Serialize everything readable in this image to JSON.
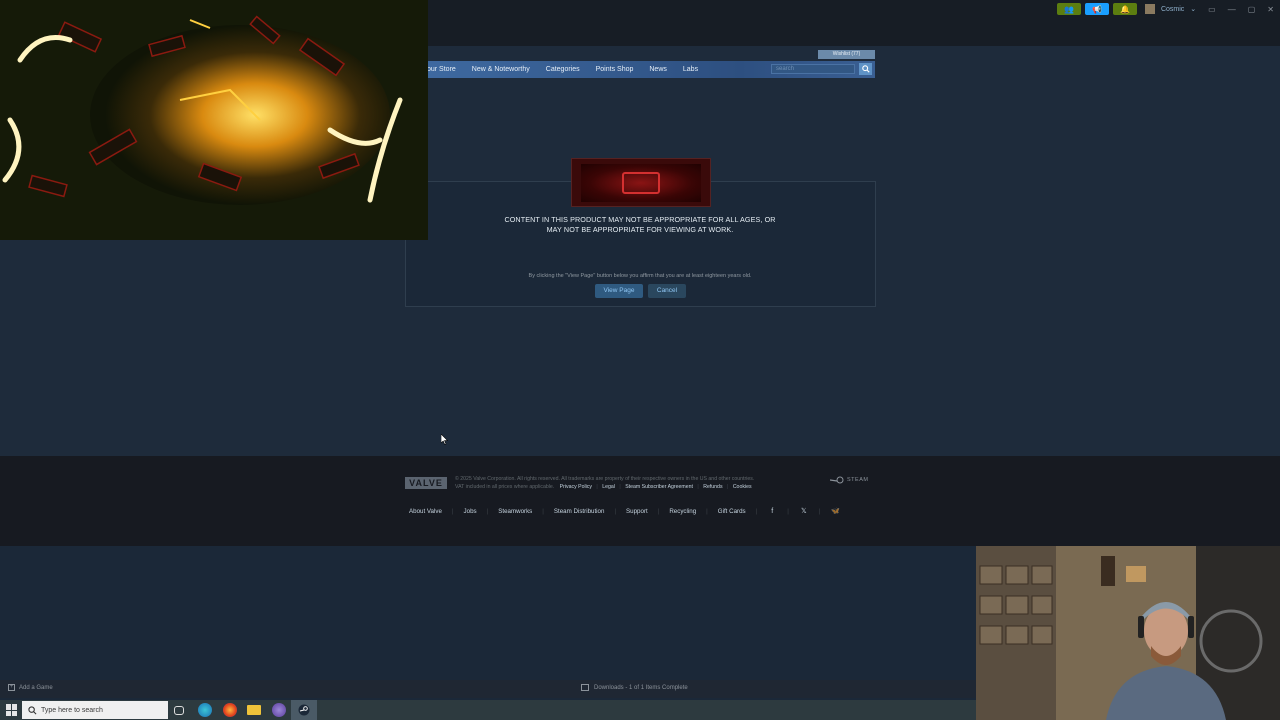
{
  "topbar": {
    "user_name": "Cosmic",
    "window_controls": [
      "▭",
      "—",
      "▢",
      "✕"
    ]
  },
  "wishlist": {
    "label": "Wishlist (77)"
  },
  "store_nav": {
    "items": [
      "our Store",
      "New & Noteworthy",
      "Categories",
      "Points Shop",
      "News",
      "Labs"
    ],
    "search_placeholder": "search"
  },
  "age_gate": {
    "warning_line1": "CONTENT IN THIS PRODUCT MAY NOT BE APPROPRIATE FOR ALL AGES, OR",
    "warning_line2": "MAY NOT BE APPROPRIATE FOR VIEWING AT WORK.",
    "affirm": "By clicking the \"View Page\" button below you affirm that you are at least eighteen years old.",
    "view_button": "View Page",
    "cancel_button": "Cancel"
  },
  "footer": {
    "valve_logo": "VALVE",
    "legal_line1": "© 2025 Valve Corporation. All rights reserved. All trademarks are property of their respective owners in the US and other countries.",
    "legal_line2_prefix": "VAT included in all prices where applicable.",
    "legal_links": [
      "Privacy Policy",
      "Legal",
      "Steam Subscriber Agreement",
      "Refunds",
      "Cookies"
    ],
    "steam_logo_text": "STEAM",
    "links": [
      "About Valve",
      "Jobs",
      "Steamworks",
      "Steam Distribution",
      "Support",
      "Recycling",
      "Gift Cards"
    ],
    "social": [
      "f",
      "𝕏",
      "🦋"
    ]
  },
  "status_bar": {
    "add_game": "Add a Game",
    "downloads": "Downloads - 1 of 1 Items Complete"
  },
  "taskbar": {
    "search_placeholder": "Type here to search"
  },
  "colors": {
    "store_bg": "#1e2b3b",
    "nav_blue": "#3e69a0",
    "footer_bg": "#171a21",
    "button_blue": "#2f5a80",
    "link_blue": "#8fc6f3"
  }
}
